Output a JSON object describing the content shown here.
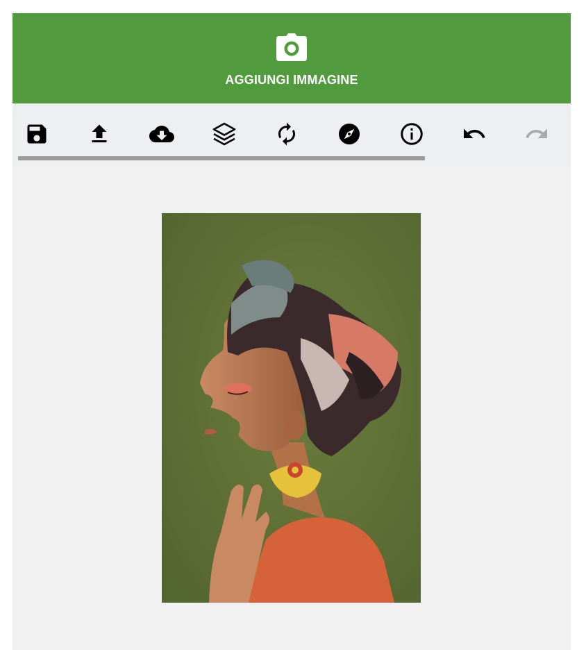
{
  "header": {
    "title": "AGGIUNGI IMMAGINE",
    "icon": "camera-icon",
    "bg_color": "#519b3e"
  },
  "toolbar": {
    "tools": [
      {
        "name": "save",
        "icon": "floppy-disk-icon",
        "enabled": true
      },
      {
        "name": "upload",
        "icon": "upload-icon",
        "enabled": true
      },
      {
        "name": "download",
        "icon": "cloud-download-icon",
        "enabled": true
      },
      {
        "name": "layers",
        "icon": "layers-icon",
        "enabled": true
      },
      {
        "name": "rotate",
        "icon": "refresh-icon",
        "enabled": true
      },
      {
        "name": "compass",
        "icon": "compass-icon",
        "enabled": true
      },
      {
        "name": "info",
        "icon": "info-icon",
        "enabled": true
      },
      {
        "name": "undo",
        "icon": "undo-icon",
        "enabled": true
      },
      {
        "name": "redo",
        "icon": "redo-icon",
        "enabled": false
      }
    ]
  },
  "canvas": {
    "image_alt": "Woman in profile with a patterned head wrap, yellow earring and orange top"
  }
}
